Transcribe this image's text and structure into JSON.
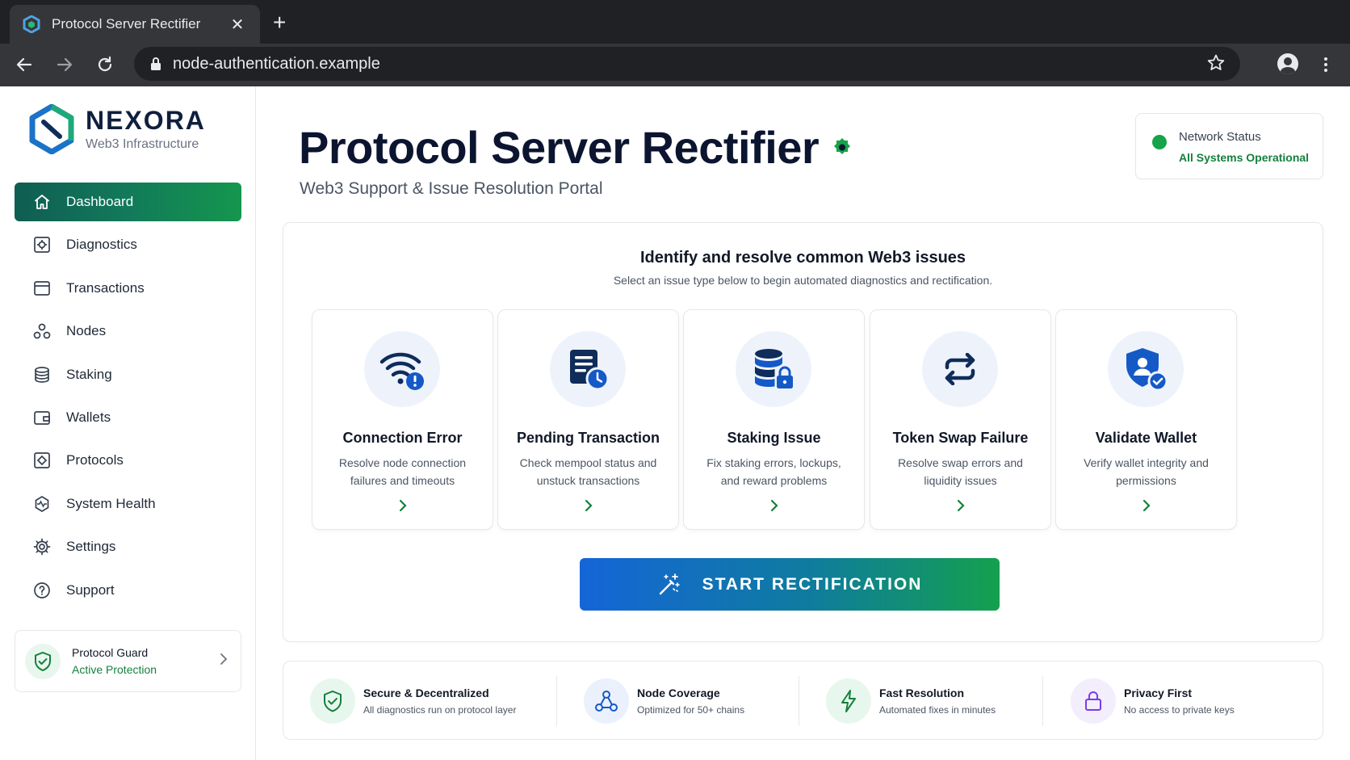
{
  "browser": {
    "tab_title": "Protocol Server Rectifier",
    "tab_close": "✕",
    "new_tab": "+",
    "url": "node-authentication.example"
  },
  "brand": {
    "name": "NEXORA",
    "tagline": "Web3 Infrastructure"
  },
  "sidebar": {
    "items": [
      {
        "label": "Dashboard",
        "icon": "home-icon",
        "active": true
      },
      {
        "label": "Diagnostics",
        "icon": "diagnostics-icon",
        "active": false
      },
      {
        "label": "Transactions",
        "icon": "transactions-icon",
        "active": false
      },
      {
        "label": "Nodes",
        "icon": "nodes-icon",
        "active": false
      },
      {
        "label": "Staking",
        "icon": "staking-icon",
        "active": false
      },
      {
        "label": "Wallets",
        "icon": "wallet-icon",
        "active": false
      },
      {
        "label": "Protocols",
        "icon": "protocols-icon",
        "active": false
      },
      {
        "label": "System Health",
        "icon": "system-health-icon",
        "active": false
      },
      {
        "label": "Settings",
        "icon": "gear-icon",
        "active": false
      },
      {
        "label": "Support",
        "icon": "help-icon",
        "active": false
      }
    ],
    "guard": {
      "title": "Protocol Guard",
      "status": "Active Protection"
    }
  },
  "header": {
    "title": "Protocol Server Rectifier",
    "subtitle": "Web3 Support & Issue Resolution Portal"
  },
  "network_status": {
    "label": "Network Status",
    "value": "All Systems Operational",
    "color": "#16a34a"
  },
  "panel": {
    "title": "Identify and resolve common Web3 issues",
    "subtitle": "Select an issue type below to begin automated diagnostics and rectification.",
    "cards": [
      {
        "title": "Connection Error",
        "description": "Resolve node connection failures and timeouts",
        "icon": "wifi-alert-icon"
      },
      {
        "title": "Pending Transaction",
        "description": "Check mempool status and unstuck transactions",
        "icon": "document-clock-icon"
      },
      {
        "title": "Staking Issue",
        "description": "Fix staking errors, lockups, and reward problems",
        "icon": "database-lock-icon"
      },
      {
        "title": "Token Swap Failure",
        "description": "Resolve swap errors and liquidity issues",
        "icon": "swap-arrows-icon"
      },
      {
        "title": "Validate Wallet",
        "description": "Verify wallet integrity and permissions",
        "icon": "shield-user-check-icon"
      }
    ],
    "cta_label": "START RECTIFICATION"
  },
  "features": [
    {
      "title": "Secure & Decentralized",
      "description": "All diagnostics run on protocol layer",
      "icon": "shield-check-icon"
    },
    {
      "title": "Node Coverage",
      "description": "Optimized for 50+ chains",
      "icon": "network-nodes-icon"
    },
    {
      "title": "Fast Resolution",
      "description": "Automated fixes in minutes",
      "icon": "lightning-icon"
    },
    {
      "title": "Privacy First",
      "description": "No access to private keys",
      "icon": "lock-icon"
    }
  ],
  "colors": {
    "primary_green": "#15964e",
    "primary_blue": "#1565d8",
    "navy": "#0b1530",
    "icon_blue": "#1559c7"
  }
}
